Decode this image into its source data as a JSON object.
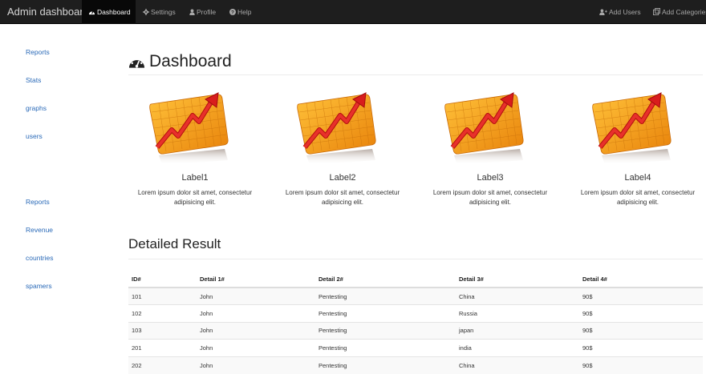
{
  "navbar": {
    "brand": "Admin dashboard",
    "items": [
      {
        "label": "Dashboard",
        "icon": "dashboard-icon",
        "active": true
      },
      {
        "label": "Settings",
        "icon": "gear-icon",
        "active": false
      },
      {
        "label": "Profile",
        "icon": "user-icon",
        "active": false
      },
      {
        "label": "Help",
        "icon": "help-icon",
        "active": false
      }
    ],
    "right_items": [
      {
        "label": "Add Users",
        "icon": "add-user-icon"
      },
      {
        "label": "Add Categories",
        "icon": "add-category-icon"
      }
    ]
  },
  "sidebar": {
    "group1": [
      "Reports",
      "Stats",
      "graphs",
      "users"
    ],
    "group2": [
      "Reports",
      "Revenue",
      "countries",
      "spamers"
    ]
  },
  "header": {
    "title": "Dashboard"
  },
  "placeholders": [
    {
      "label": "Label1",
      "text": "Lorem ipsum dolor sit amet, consectetur adipisicing elit."
    },
    {
      "label": "Label2",
      "text": "Lorem ipsum dolor sit amet, consectetur adipisicing elit."
    },
    {
      "label": "Label3",
      "text": "Lorem ipsum dolor sit amet, consectetur adipisicing elit."
    },
    {
      "label": "Label4",
      "text": "Lorem ipsum dolor sit amet, consectetur adipisicing elit."
    }
  ],
  "detail": {
    "title": "Detailed Result",
    "columns": [
      "ID#",
      "Detail 1#",
      "Detail 2#",
      "Detail 3#",
      "Detail 4#"
    ],
    "rows": [
      [
        "101",
        "John",
        "Pentesting",
        "China",
        "90$"
      ],
      [
        "102",
        "John",
        "Pentesting",
        "Russia",
        "90$"
      ],
      [
        "103",
        "John",
        "Pentesting",
        "japan",
        "90$"
      ],
      [
        "201",
        "John",
        "Pentesting",
        "india",
        "90$"
      ],
      [
        "202",
        "John",
        "Pentesting",
        "China",
        "90$"
      ]
    ]
  },
  "colors": {
    "navbar_bg": "#1e1e1e",
    "active_bg": "#080808",
    "link": "#2a6ab8",
    "chart_orange": "#f7a21a",
    "arrow_red": "#d81d1d"
  }
}
